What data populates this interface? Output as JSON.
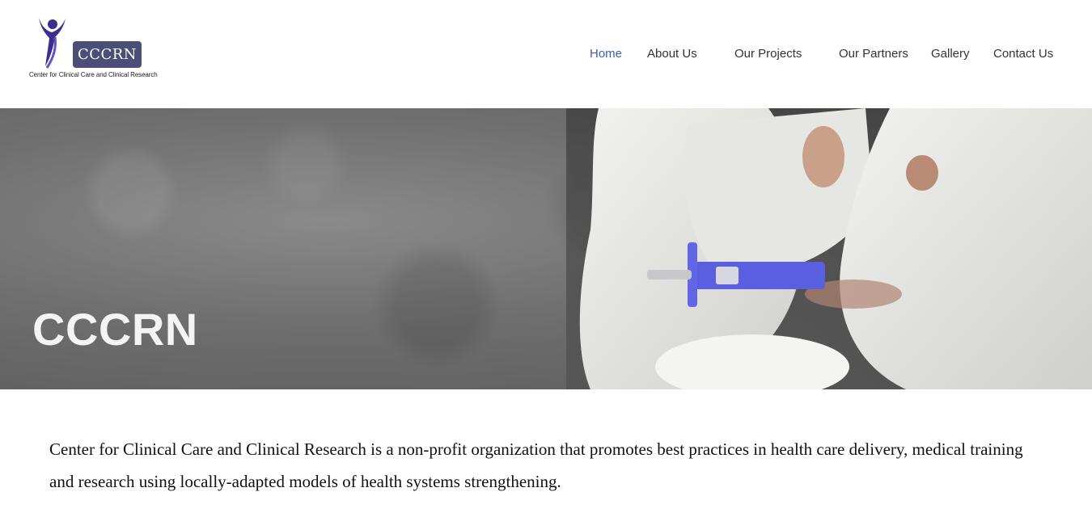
{
  "logo": {
    "badge_text": "CCCRN",
    "caption": "Center for Clinical Care and Clinical Research",
    "colors": {
      "badge": "#4b4f78",
      "figure": "#3a2f8f",
      "figure_accent": "#6a4fc8"
    }
  },
  "nav": {
    "items": [
      {
        "label": "Home",
        "active": true
      },
      {
        "label": "About Us"
      },
      {
        "label": "Our Projects"
      },
      {
        "label": "Our Partners"
      },
      {
        "label": "Gallery"
      },
      {
        "label": "Contact Us"
      }
    ],
    "active_color": "#3c5fb2"
  },
  "hero": {
    "title": "CCCRN"
  },
  "intro": {
    "text": "Center for Clinical Care and Clinical Research is a non-profit organization that promotes best practices in health care delivery, medical training and research using locally-adapted models of health systems strengthening."
  }
}
